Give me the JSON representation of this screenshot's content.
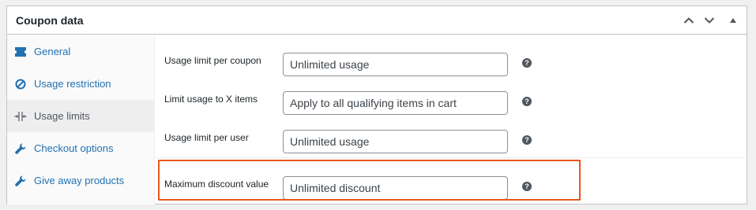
{
  "panel": {
    "title": "Coupon data",
    "buttons": [
      "move-up",
      "move-down",
      "toggle"
    ]
  },
  "sidebar": {
    "items": [
      {
        "label": "General",
        "icon": "ticket-icon",
        "active": false
      },
      {
        "label": "Usage restriction",
        "icon": "block-icon",
        "active": false
      },
      {
        "label": "Usage limits",
        "icon": "limits-icon",
        "active": true
      },
      {
        "label": "Checkout options",
        "icon": "wrench-icon",
        "active": false
      },
      {
        "label": "Give away products",
        "icon": "wrench-icon",
        "active": false
      }
    ]
  },
  "fields": [
    {
      "label": "Usage limit per coupon",
      "placeholder": "Unlimited usage"
    },
    {
      "label": "Limit usage to X items",
      "placeholder": "Apply to all qualifying items in cart"
    },
    {
      "label": "Usage limit per user",
      "placeholder": "Unlimited usage"
    },
    {
      "label": "Maximum discount value",
      "placeholder": "Unlimited discount"
    }
  ],
  "help_glyph": "?",
  "colors": {
    "link": "#2271b1",
    "highlight": "#e8571f",
    "active_tab_bg": "#eeeeee"
  }
}
